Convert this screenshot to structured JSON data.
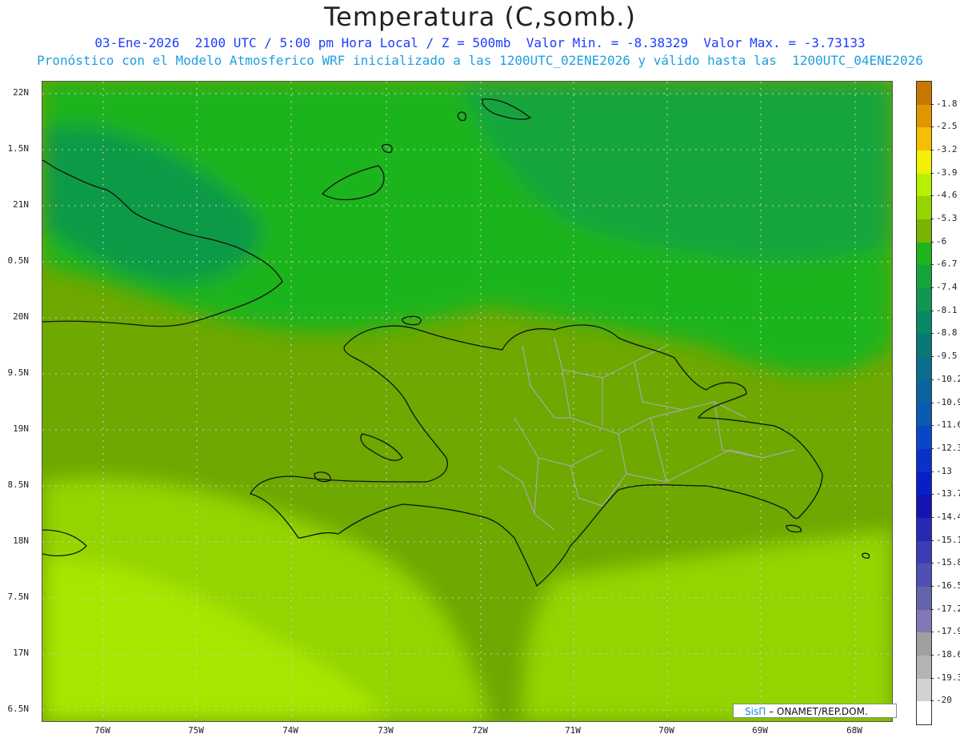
{
  "title": "Temperatura (C,somb.)",
  "subtitle_line1": "03-Ene-2026  2100 UTC / 5:00 pm Hora Local / Z = 500mb  Valor Min. = -8.38329  Valor Max. = -3.73133",
  "subtitle_line2": "Pronóstico con el Modelo Atmosferico WRF inicializado a las 1200UTC_02ENE2026 y válido hasta las  1200UTC_04ENE2026",
  "y_ticks": [
    "22N",
    "21.5N",
    "21N",
    "20.5N",
    "20N",
    "19.5N",
    "19N",
    "18.5N",
    "18N",
    "17.5N",
    "17N",
    "16.5N"
  ],
  "y_tick_display": [
    "22N",
    "1.5N",
    "21N",
    "0.5N",
    "20N",
    "9.5N",
    "19N",
    "8.5N",
    "18N",
    "7.5N",
    "17N",
    "6.5N"
  ],
  "x_ticks": [
    "76W",
    "75W",
    "74W",
    "73W",
    "72W",
    "71W",
    "70W",
    "69W",
    "68W"
  ],
  "colorbar": {
    "labels": [
      "-1.8",
      "-2.5",
      "-3.2",
      "-3.9",
      "-4.6",
      "-5.3",
      "-6",
      "-6.7",
      "-7.4",
      "-8.1",
      "-8.8",
      "-9.5",
      "-10.2",
      "-10.9",
      "-11.6",
      "-12.3",
      "-13",
      "-13.7",
      "-14.4",
      "-15.1",
      "-15.8",
      "-16.5",
      "-17.2",
      "-17.9",
      "-18.6",
      "-19.3",
      "-20"
    ],
    "colors": [
      "#c87800",
      "#e09600",
      "#f5be00",
      "#f0f000",
      "#b8f000",
      "#94d400",
      "#78b400",
      "#1eb41e",
      "#14a53c",
      "#0f9650",
      "#0a8764",
      "#0a7878",
      "#0a6e8c",
      "#0a64a0",
      "#0a5ab4",
      "#0a46c8",
      "#0a32c8",
      "#0a1ec8",
      "#1414b4",
      "#2828b4",
      "#3c3cb4",
      "#5050b4",
      "#6464aa",
      "#8278b4",
      "#a0a0a0",
      "#b4b4b4",
      "#d2d2d2",
      "#ffffff"
    ]
  },
  "credit": {
    "brand": "SisΠ",
    "text": "– ONAMET/REP.DOM."
  },
  "field_colors": {
    "north_band": "#14a53c",
    "mid_band": "#1eb41e",
    "central": "#6ea800",
    "south_west": "#94d400",
    "south_far": "#a8e600",
    "deep_green": "#0a9a46"
  }
}
